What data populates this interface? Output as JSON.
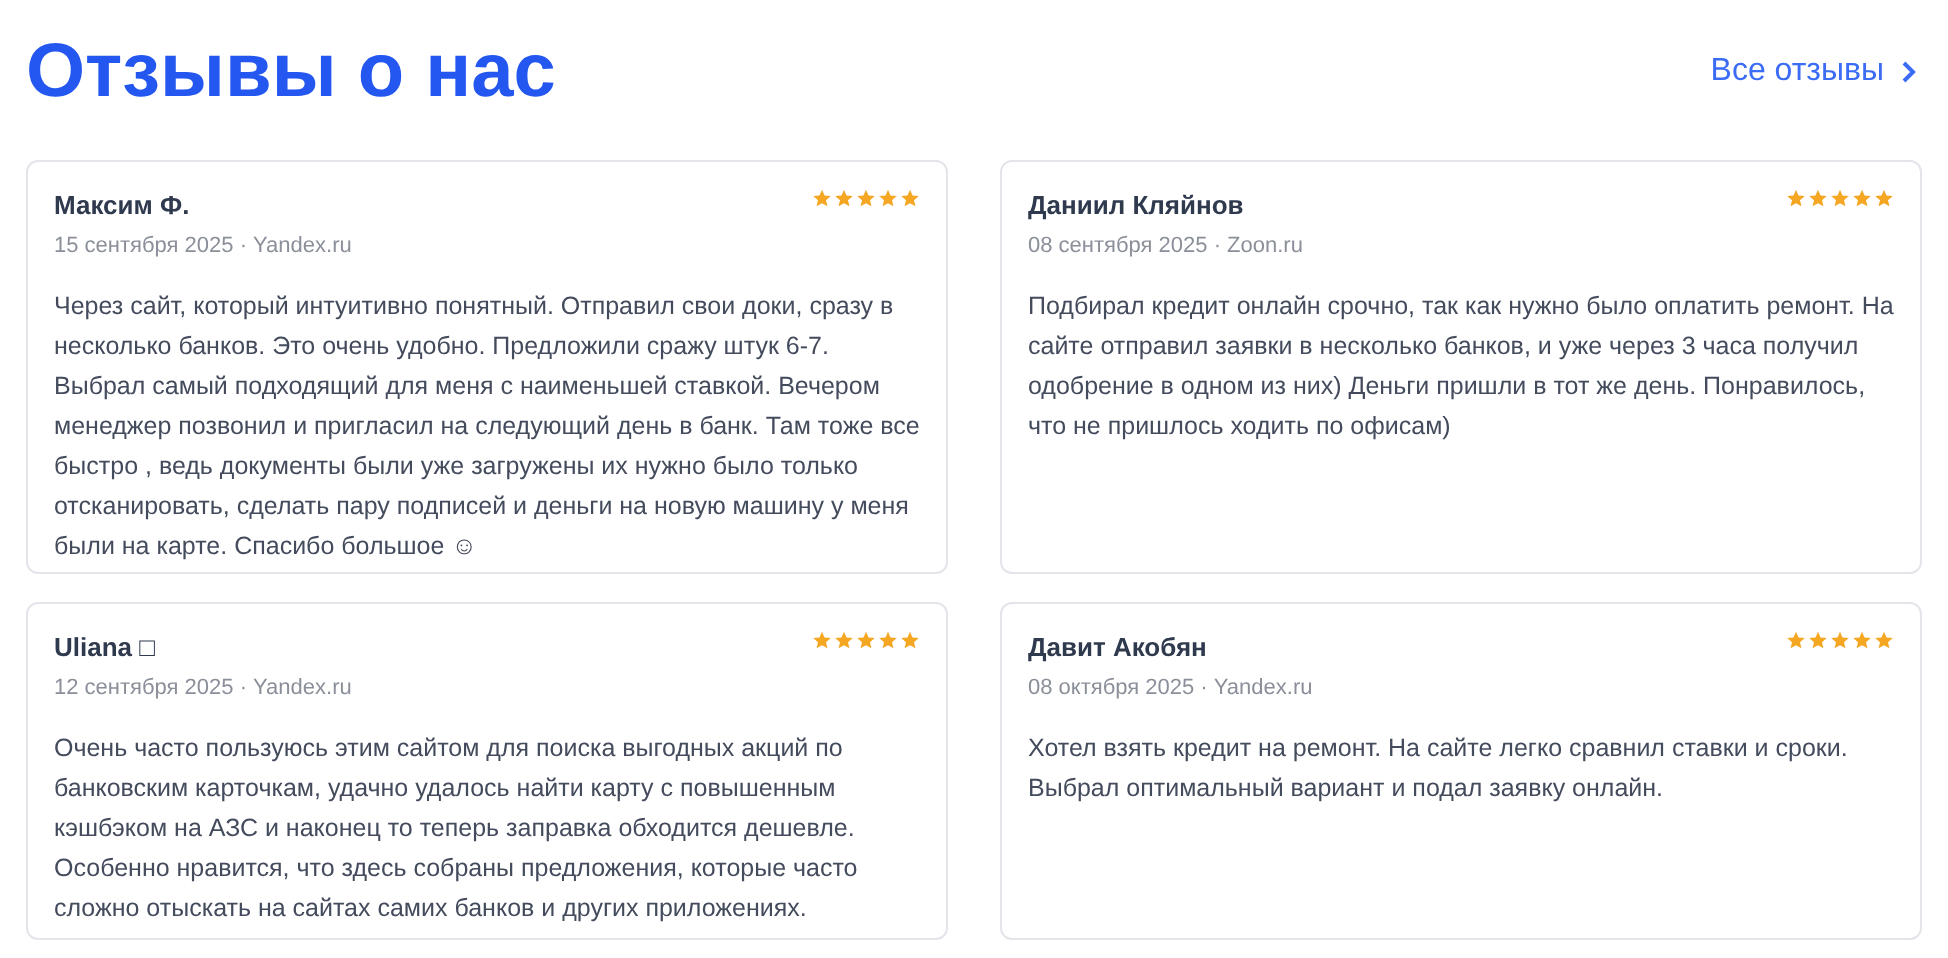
{
  "title": "Отзывы о нас",
  "all_link": {
    "label": "Все отзывы"
  },
  "reviews": [
    {
      "author": "Максим Ф.",
      "meta": "15 сентября 2025 · Yandex.ru",
      "stars": 5,
      "text": "Через сайт, который интуитивно понятный. Отправил свои доки, сразу в несколько банков. Это очень удобно. Предложили сражу штук 6-7. Выбрал самый подходящий для меня с наименьшей ставкой. Вечером менеджер позвонил и пригласил на следующий день в банк. Там тоже все быстро , ведь документы были уже загружены их нужно было только отсканировать, сделать пару подписей и деньги на новую машину у меня были на карте. Спасибо большое ☺"
    },
    {
      "author": "Даниил Кляйнов",
      "meta": "08 сентября 2025 · Zoon.ru",
      "stars": 5,
      "text": "Подбирал кредит онлайн срочно, так как нужно было оплатить ремонт. На сайте отправил заявки в несколько банков, и уже через 3 часа получил одобрение в одном из них) Деньги пришли в тот же день. Понравилось, что не пришлось ходить по офисам)"
    },
    {
      "author": "Uliana □",
      "meta": "12 сентября 2025 · Yandex.ru",
      "stars": 5,
      "text": "Очень часто пользуюсь этим сайтом для поиска выгодных акций по банковским карточкам, удачно удалось найти карту с повышенным кэшбэком на АЗС и наконец то теперь заправка обходится дешевле. Особенно нравится, что здесь собраны предложения, которые часто сложно отыскать на сайтах самих банков и других приложениях."
    },
    {
      "author": "Давит Акобян",
      "meta": "08 октября 2025 · Yandex.ru",
      "stars": 5,
      "text": "Хотел взять кредит на ремонт. На сайте легко сравнил ставки и сроки. Выбрал оптимальный вариант и подал заявку онлайн."
    }
  ]
}
